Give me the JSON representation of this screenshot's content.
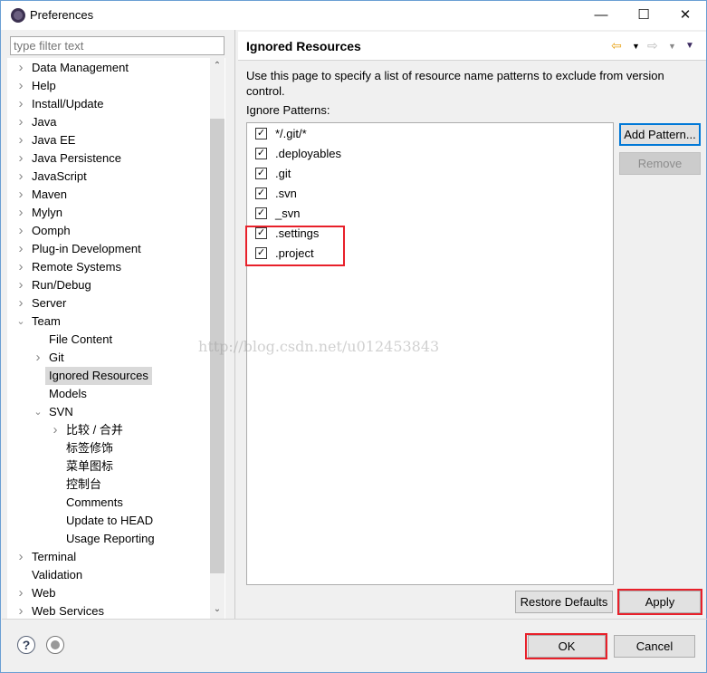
{
  "window": {
    "title": "Preferences",
    "minimize": "—",
    "maximize": "☐",
    "close": "✕"
  },
  "filter": {
    "placeholder": "type filter text"
  },
  "tree": [
    {
      "label": "Data Management",
      "level": 0,
      "expander": "collapsed"
    },
    {
      "label": "Help",
      "level": 0,
      "expander": "collapsed"
    },
    {
      "label": "Install/Update",
      "level": 0,
      "expander": "collapsed"
    },
    {
      "label": "Java",
      "level": 0,
      "expander": "collapsed"
    },
    {
      "label": "Java EE",
      "level": 0,
      "expander": "collapsed"
    },
    {
      "label": "Java Persistence",
      "level": 0,
      "expander": "collapsed"
    },
    {
      "label": "JavaScript",
      "level": 0,
      "expander": "collapsed"
    },
    {
      "label": "Maven",
      "level": 0,
      "expander": "collapsed"
    },
    {
      "label": "Mylyn",
      "level": 0,
      "expander": "collapsed"
    },
    {
      "label": "Oomph",
      "level": 0,
      "expander": "collapsed"
    },
    {
      "label": "Plug-in Development",
      "level": 0,
      "expander": "collapsed"
    },
    {
      "label": "Remote Systems",
      "level": 0,
      "expander": "collapsed"
    },
    {
      "label": "Run/Debug",
      "level": 0,
      "expander": "collapsed"
    },
    {
      "label": "Server",
      "level": 0,
      "expander": "collapsed"
    },
    {
      "label": "Team",
      "level": 0,
      "expander": "expanded"
    },
    {
      "label": "File Content",
      "level": 1,
      "expander": "none"
    },
    {
      "label": "Git",
      "level": 1,
      "expander": "collapsed"
    },
    {
      "label": "Ignored Resources",
      "level": 1,
      "expander": "none",
      "selected": true
    },
    {
      "label": "Models",
      "level": 1,
      "expander": "none"
    },
    {
      "label": "SVN",
      "level": 1,
      "expander": "expanded"
    },
    {
      "label": "比较 / 合并",
      "level": 2,
      "expander": "collapsed"
    },
    {
      "label": "标签修饰",
      "level": 2,
      "expander": "none"
    },
    {
      "label": "菜单图标",
      "level": 2,
      "expander": "none"
    },
    {
      "label": "控制台",
      "level": 2,
      "expander": "none"
    },
    {
      "label": "Comments",
      "level": 2,
      "expander": "none"
    },
    {
      "label": "Update to HEAD",
      "level": 2,
      "expander": "none"
    },
    {
      "label": "Usage Reporting",
      "level": 2,
      "expander": "none"
    },
    {
      "label": "Terminal",
      "level": 0,
      "expander": "collapsed"
    },
    {
      "label": "Validation",
      "level": 0,
      "expander": "none"
    },
    {
      "label": "Web",
      "level": 0,
      "expander": "collapsed"
    },
    {
      "label": "Web Services",
      "level": 0,
      "expander": "collapsed"
    }
  ],
  "page": {
    "title": "Ignored Resources",
    "description": "Use this page to specify a list of resource name patterns to exclude from version control.",
    "patterns_label": "Ignore Patterns:",
    "patterns": [
      {
        "name": "*/.git/*",
        "checked": true
      },
      {
        "name": ".deployables",
        "checked": true
      },
      {
        "name": ".git",
        "checked": true
      },
      {
        "name": ".svn",
        "checked": true
      },
      {
        "name": "_svn",
        "checked": true
      },
      {
        "name": ".settings",
        "checked": true
      },
      {
        "name": ".project",
        "checked": true
      }
    ],
    "add_pattern": "Add Pattern...",
    "remove": "Remove",
    "restore_defaults": "Restore Defaults",
    "apply": "Apply"
  },
  "footer": {
    "ok": "OK",
    "cancel": "Cancel",
    "help_icon": "?"
  },
  "watermark": "http://blog.csdn.net/u012453843",
  "colors": {
    "highlight": "#e8202a",
    "focus": "#0078d7",
    "selection": "#d9d9d9"
  }
}
